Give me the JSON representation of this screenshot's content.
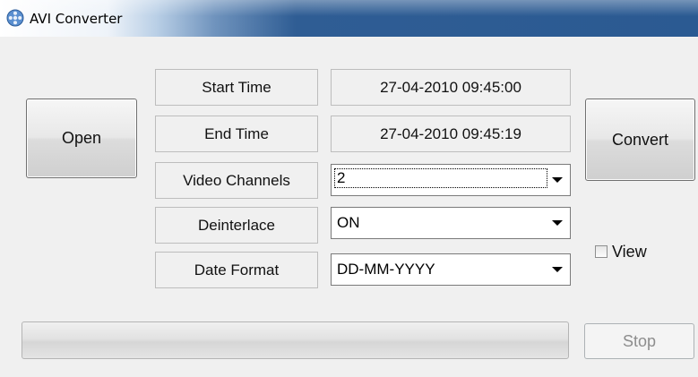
{
  "window": {
    "title": "AVI Converter",
    "icon": "film-reel-icon"
  },
  "buttons": {
    "open": "Open",
    "convert": "Convert",
    "stop": "Stop"
  },
  "fields": {
    "start_time": {
      "label": "Start Time",
      "value": "27-04-2010 09:45:00"
    },
    "end_time": {
      "label": "End Time",
      "value": "27-04-2010 09:45:19"
    },
    "video_channels": {
      "label": "Video Channels",
      "value": "2"
    },
    "deinterlace": {
      "label": "Deinterlace",
      "value": "ON"
    },
    "date_format": {
      "label": "Date Format",
      "value": "DD-MM-YYYY"
    }
  },
  "view_checkbox": {
    "label": "View",
    "checked": false
  },
  "progress": {
    "value": 0
  },
  "colors": {
    "titlebar_accent": "#2b5a92",
    "disabled_text": "#8d8d8d"
  }
}
